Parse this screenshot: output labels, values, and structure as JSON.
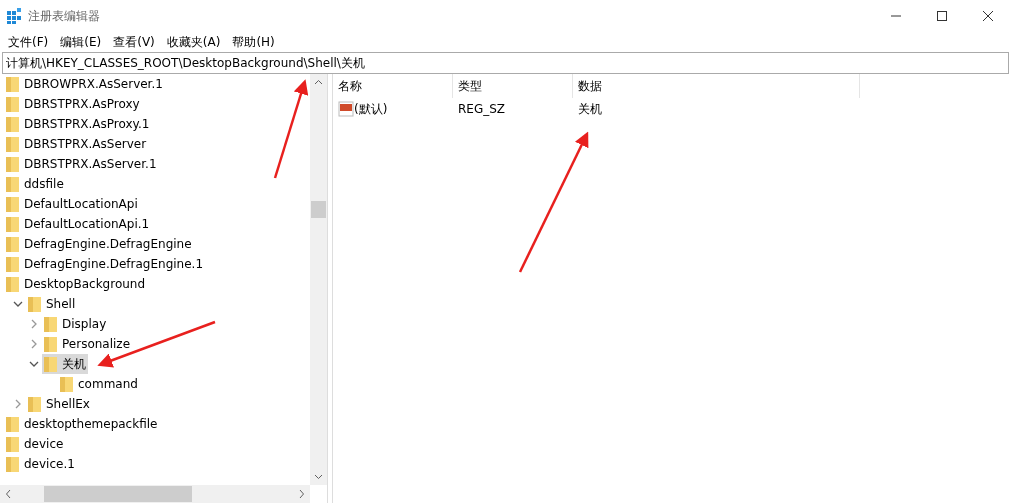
{
  "window": {
    "title": "注册表编辑器"
  },
  "menu": [
    {
      "label": "文件(F)"
    },
    {
      "label": "编辑(E)"
    },
    {
      "label": "查看(V)"
    },
    {
      "label": "收藏夹(A)"
    },
    {
      "label": "帮助(H)"
    }
  ],
  "address": "计算机\\HKEY_CLASSES_ROOT\\DesktopBackground\\Shell\\关机",
  "tree": [
    {
      "label": "DBROWPRX.AsServer.1",
      "selected": false
    },
    {
      "label": "DBRSTPRX.AsProxy",
      "selected": false
    },
    {
      "label": "DBRSTPRX.AsProxy.1",
      "selected": false
    },
    {
      "label": "DBRSTPRX.AsServer",
      "selected": false
    },
    {
      "label": "DBRSTPRX.AsServer.1",
      "selected": false
    },
    {
      "label": "ddsfile",
      "selected": false
    },
    {
      "label": "DefaultLocationApi",
      "selected": false
    },
    {
      "label": "DefaultLocationApi.1",
      "selected": false
    },
    {
      "label": "DefragEngine.DefragEngine",
      "selected": false
    },
    {
      "label": "DefragEngine.DefragEngine.1",
      "selected": false
    },
    {
      "label": "DesktopBackground",
      "selected": false,
      "children": [
        {
          "label": "Shell",
          "selected": false,
          "expanded": true,
          "children": [
            {
              "label": "Display",
              "selected": false,
              "expanded": false
            },
            {
              "label": "Personalize",
              "selected": false,
              "expanded": false
            },
            {
              "label": "关机",
              "selected": true,
              "expanded": true,
              "children": [
                {
                  "label": "command",
                  "selected": false
                }
              ]
            }
          ]
        },
        {
          "label": "ShellEx",
          "selected": false,
          "expanded": false
        }
      ]
    },
    {
      "label": "desktopthemepackfile",
      "selected": false
    },
    {
      "label": "device",
      "selected": false
    },
    {
      "label": "device.1",
      "selected": false
    }
  ],
  "table": {
    "columns": [
      "名称",
      "类型",
      "数据"
    ],
    "rows": [
      {
        "name": "(默认)",
        "type": "REG_SZ",
        "data": "关机",
        "selected": false
      }
    ]
  }
}
